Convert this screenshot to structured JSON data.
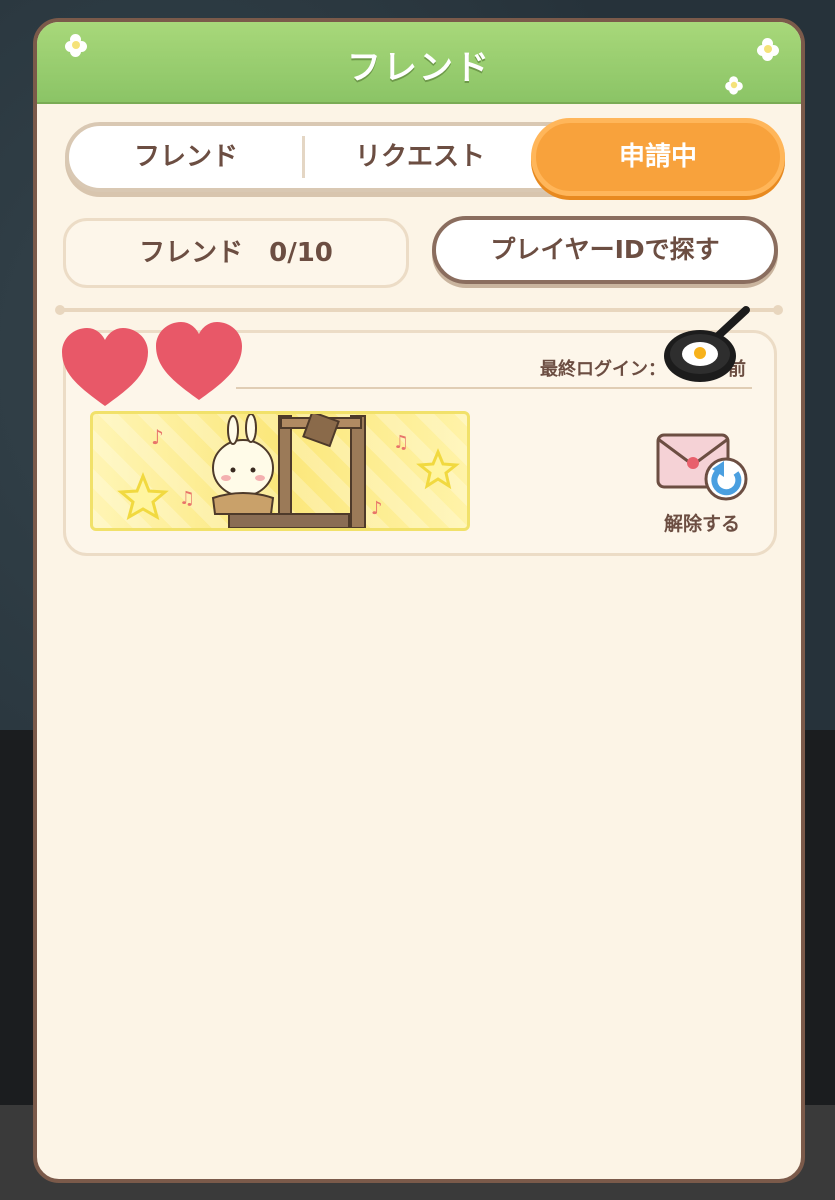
{
  "dialog": {
    "title": "フレンド"
  },
  "tabs": [
    {
      "label": "フレンド",
      "selected": false
    },
    {
      "label": "リクエスト",
      "selected": false
    },
    {
      "label": "申請中",
      "selected": true
    }
  ],
  "friend_count_label": "フレンド　0/10",
  "search_button_label": "プレイヤーIDで探す",
  "request_card": {
    "last_login_label": "最終ログイン：",
    "last_login_value_suffix": "前",
    "release_button_label": "解除する"
  },
  "colors": {
    "header_green": "#8bc466",
    "tab_active_orange": "#f8a23c",
    "text_brown": "#6c4e42",
    "panel_cream": "#fcf4e6",
    "border_brown": "#7b5a4a"
  },
  "icons": {
    "release": "envelope-return-icon",
    "overlay_hearts": "heart-icon",
    "overlay_pan": "frying-pan-icon"
  }
}
